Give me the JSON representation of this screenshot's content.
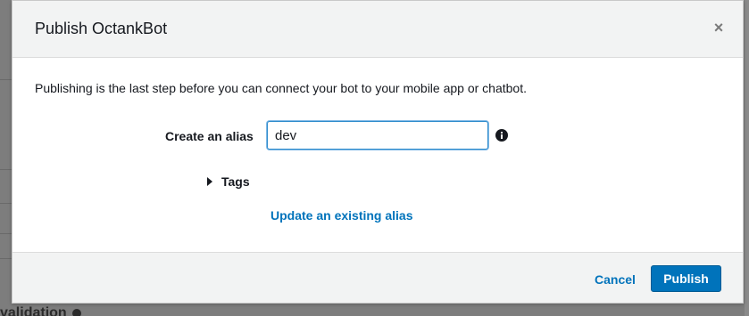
{
  "background": {
    "partial_text": "validation"
  },
  "dialog": {
    "title": "Publish OctankBot",
    "close_glyph": "×",
    "description": "Publishing is the last step before you can connect your bot to your mobile app or chatbot.",
    "alias": {
      "label": "Create an alias",
      "value": "dev",
      "info_icon": "info-circle-icon"
    },
    "tags": {
      "label": "Tags",
      "expanded": false
    },
    "update_link": "Update an existing alias",
    "footer": {
      "cancel_label": "Cancel",
      "publish_label": "Publish"
    }
  },
  "colors": {
    "primary": "#0073bb",
    "header_bg": "#f2f3f3",
    "overlay": "#7d7d7d",
    "input_focus": "#2f8ccc"
  }
}
